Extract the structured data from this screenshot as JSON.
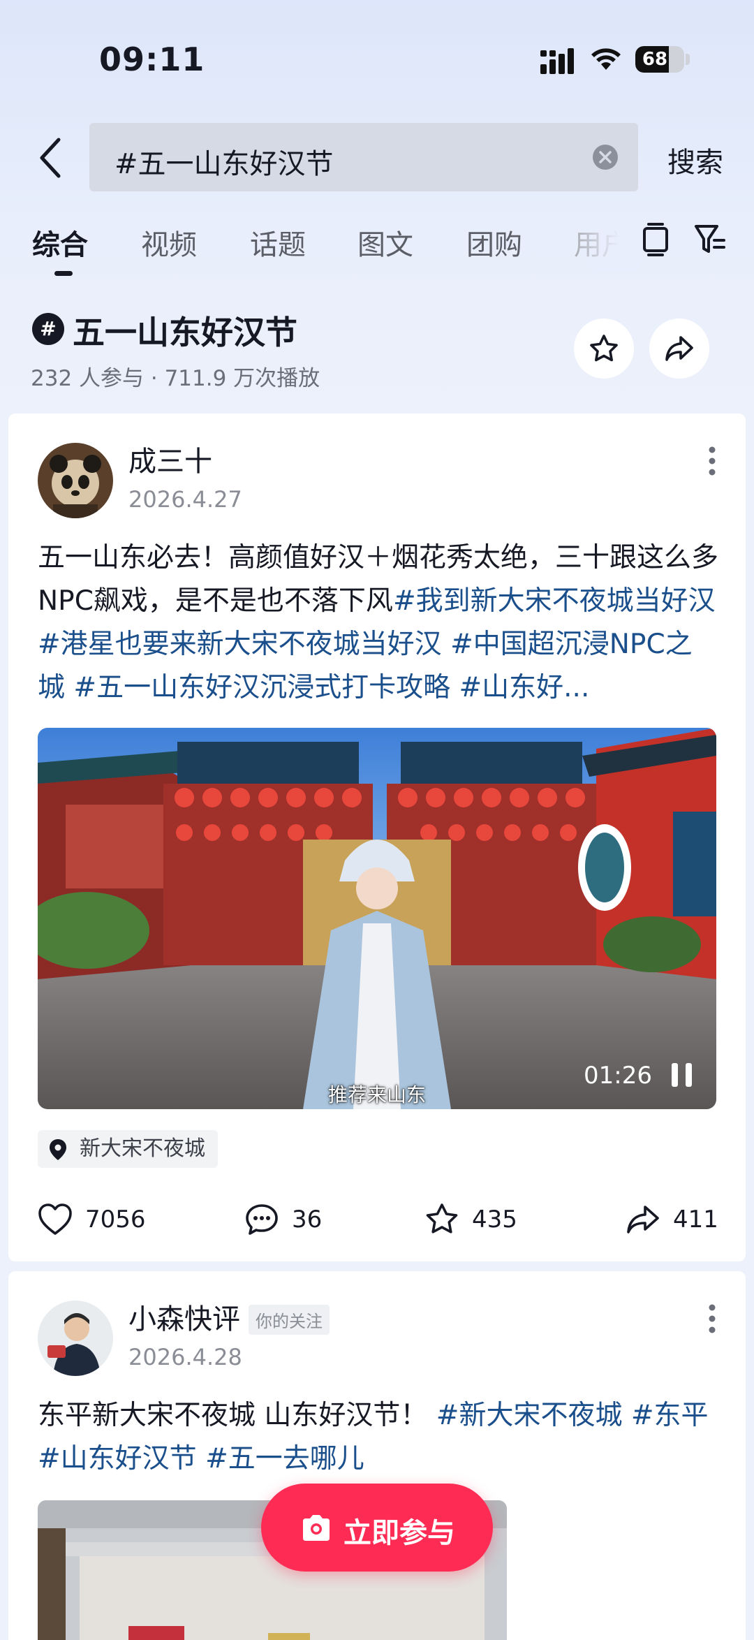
{
  "status_bar": {
    "time": "09:11",
    "battery": "68",
    "battery_level": 0.68
  },
  "search": {
    "query": "#五一山东好汉节",
    "search_label": "搜索"
  },
  "tabs": [
    {
      "label": "综合",
      "active": true
    },
    {
      "label": "视频"
    },
    {
      "label": "话题"
    },
    {
      "label": "图文"
    },
    {
      "label": "团购"
    },
    {
      "label": "用户"
    }
  ],
  "topic": {
    "badge": "#",
    "title": "五一山东好汉节",
    "stats": "232 人参与 · 711.9 万次播放"
  },
  "posts": [
    {
      "author": "成三十",
      "date": "2026.4.27",
      "text_plain": "五一山东必去！高颜值好汉＋烟花秀太绝，三十跟这么多NPC飙戏，是不是也不落下风",
      "tags": "#我到新大宋不夜城当好汉#港星也要来新大宋不夜城当好汉 #中国超沉浸NPC之城 #五一山东好汉沉浸式打卡攻略 #山东好...",
      "video_time": "01:26",
      "subtitle": "推荐来山东",
      "location": "新大宋不夜城",
      "likes": "7056",
      "comments": "36",
      "favorites": "435",
      "shares": "411"
    },
    {
      "author": "小森快评",
      "follow_badge": "你的关注",
      "date": "2026.4.28",
      "text_plain": "东平新大宋不夜城 山东好汉节！",
      "tags": " #新大宋不夜城 #东平 #山东好汉节 #五一去哪儿"
    }
  ],
  "join_button": "立即参与",
  "colors": {
    "accent": "#fe2c55",
    "tag": "#1a4f8c",
    "background": "#edf1fb"
  }
}
